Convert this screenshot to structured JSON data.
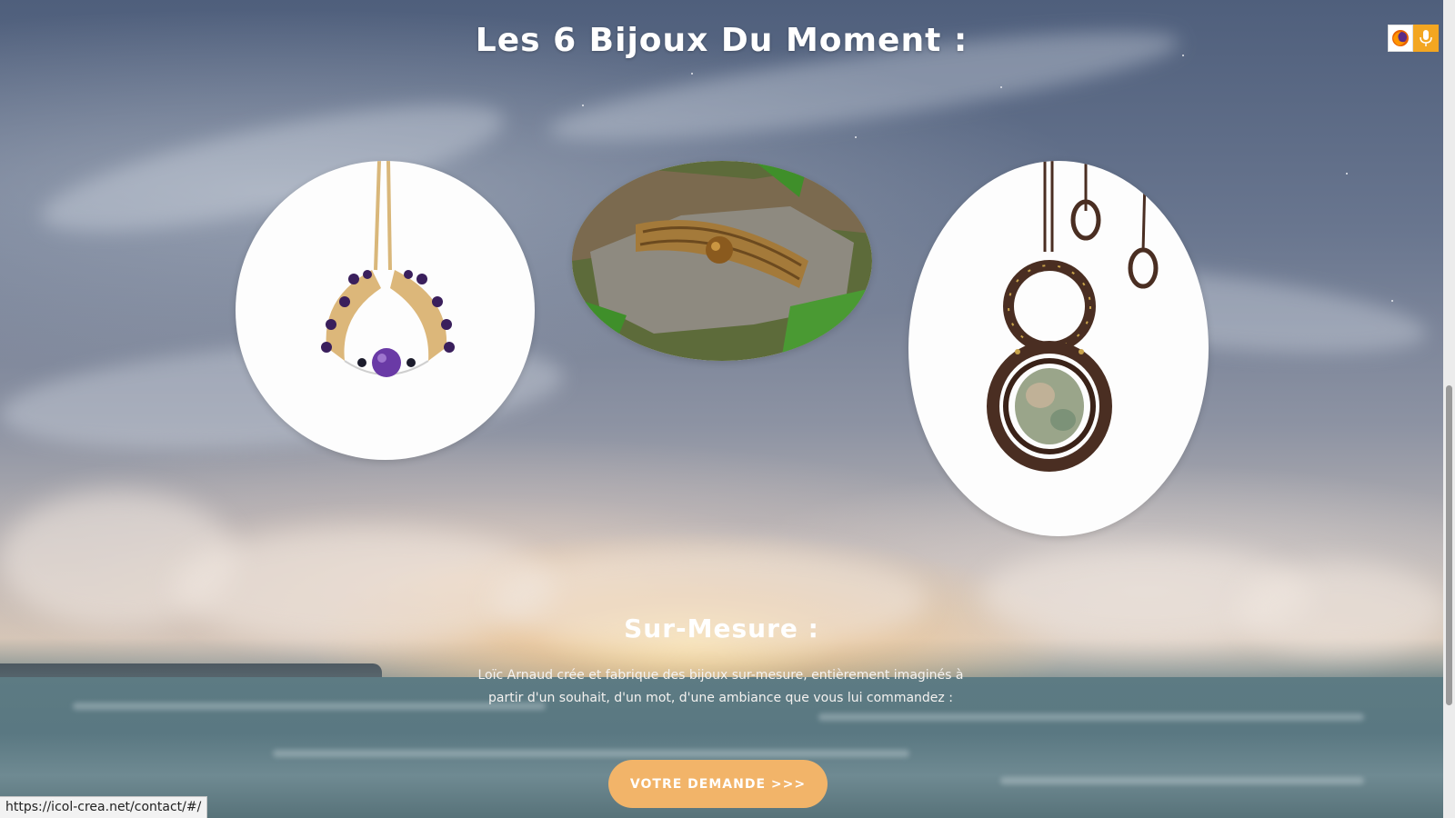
{
  "section": {
    "title": "Les 6 Bijoux Du Moment :"
  },
  "jewels": [
    {
      "name": "amethyst-macrame-necklace",
      "colors": {
        "cord": "#d9b77a",
        "bead": "#3a1f5c",
        "stone": "#6a3aa6"
      }
    },
    {
      "name": "tiger-eye-macrame-bracelet",
      "colors": {
        "cord": "#a47a3a",
        "stone": "#8a5a1e",
        "rock": "#8e8a80",
        "moss": "#3f8f2a"
      }
    },
    {
      "name": "labradorite-macrame-pendant",
      "colors": {
        "cord": "#4a2e22",
        "stone": "#9aa58a",
        "accent": "#c7a24a"
      }
    }
  ],
  "custom": {
    "title": "Sur-Mesure :",
    "description": "Loïc Arnaud crée et fabrique des bijoux sur-mesure, entièrement imaginés à partir d'un souhait, d'un mot, d'une ambiance que vous lui commandez :",
    "cta_label": "VOTRE DEMANDE >>>"
  },
  "status_bar": {
    "url": "https://icol-crea.net/contact/#/"
  },
  "extension": {
    "firefox_icon": "firefox-icon",
    "mic_icon": "microphone-icon"
  },
  "theme": {
    "accent": "#f2b469",
    "text": "#ffffff"
  }
}
